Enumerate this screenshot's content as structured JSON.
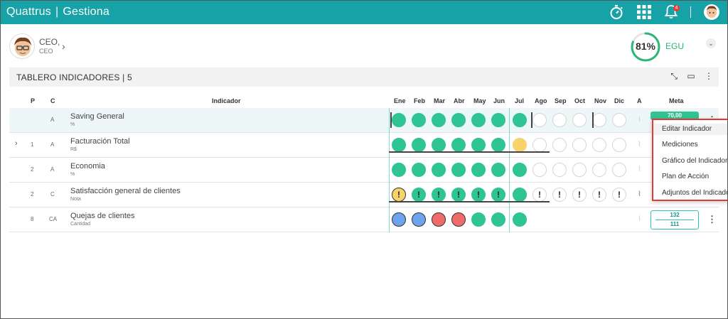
{
  "app": {
    "brand": "Quattrus",
    "product": "Gestiona",
    "notifications": "4"
  },
  "user": {
    "title": "CEO,",
    "subtitle": "CEO"
  },
  "score": {
    "value": "81%",
    "label": "EGU",
    "percent": 81
  },
  "dashboard": {
    "title": "TABLERO INDICADORES | 5"
  },
  "columns": {
    "p": "P",
    "c": "C",
    "indicador": "Indicador",
    "months": [
      "Ene",
      "Feb",
      "Mar",
      "Abr",
      "May",
      "Jun",
      "Jul",
      "Ago",
      "Sep",
      "Oct",
      "Nov",
      "Dic"
    ],
    "a": "A",
    "meta": "Meta"
  },
  "rows": [
    {
      "p": "",
      "c": "A",
      "name": "Saving General",
      "unit": "%",
      "meta": "70,00",
      "dots": [
        "g",
        "g",
        "g",
        "g",
        "g",
        "g",
        "g",
        "e",
        "e",
        "e",
        "e",
        "e"
      ]
    },
    {
      "p": "1",
      "c": "A",
      "name": "Facturación Total",
      "unit": "R$",
      "dots": [
        "g",
        "g",
        "g",
        "g",
        "g",
        "g",
        "y",
        "e",
        "e",
        "e",
        "e",
        "e"
      ]
    },
    {
      "p": "2",
      "c": "A",
      "name": "Economia",
      "unit": "%",
      "dots": [
        "g",
        "g",
        "g",
        "g",
        "g",
        "g",
        "g",
        "e",
        "e",
        "e",
        "e",
        "e"
      ]
    },
    {
      "p": "2",
      "c": "C",
      "name": "Satisfacción general de clientes",
      "unit": "Nota",
      "dots": [
        "ye!",
        "g!",
        "g!",
        "g!",
        "g!",
        "g!",
        "g",
        "e!",
        "e!",
        "e!",
        "e!",
        "e!"
      ]
    },
    {
      "p": "8",
      "c": "CA",
      "name": "Quejas de clientes",
      "unit": "Cantidad",
      "meta_top": "132",
      "meta_bottom": "111",
      "dots": [
        "b",
        "b",
        "r",
        "r",
        "g",
        "g",
        "g",
        "",
        "",
        "",
        "",
        ""
      ]
    }
  ],
  "menu": {
    "items": [
      "Editar Indicador",
      "Mediciones",
      "Gráfico del Indicador",
      "Plan de Acción",
      "Adjuntos del Indicador"
    ]
  },
  "colors": {
    "primary": "#17a2a7",
    "green": "#2ec493",
    "yellow": "#f6d36b",
    "red": "#ef6b6b",
    "blue": "#6fa2ec",
    "highlight": "#e53935"
  }
}
